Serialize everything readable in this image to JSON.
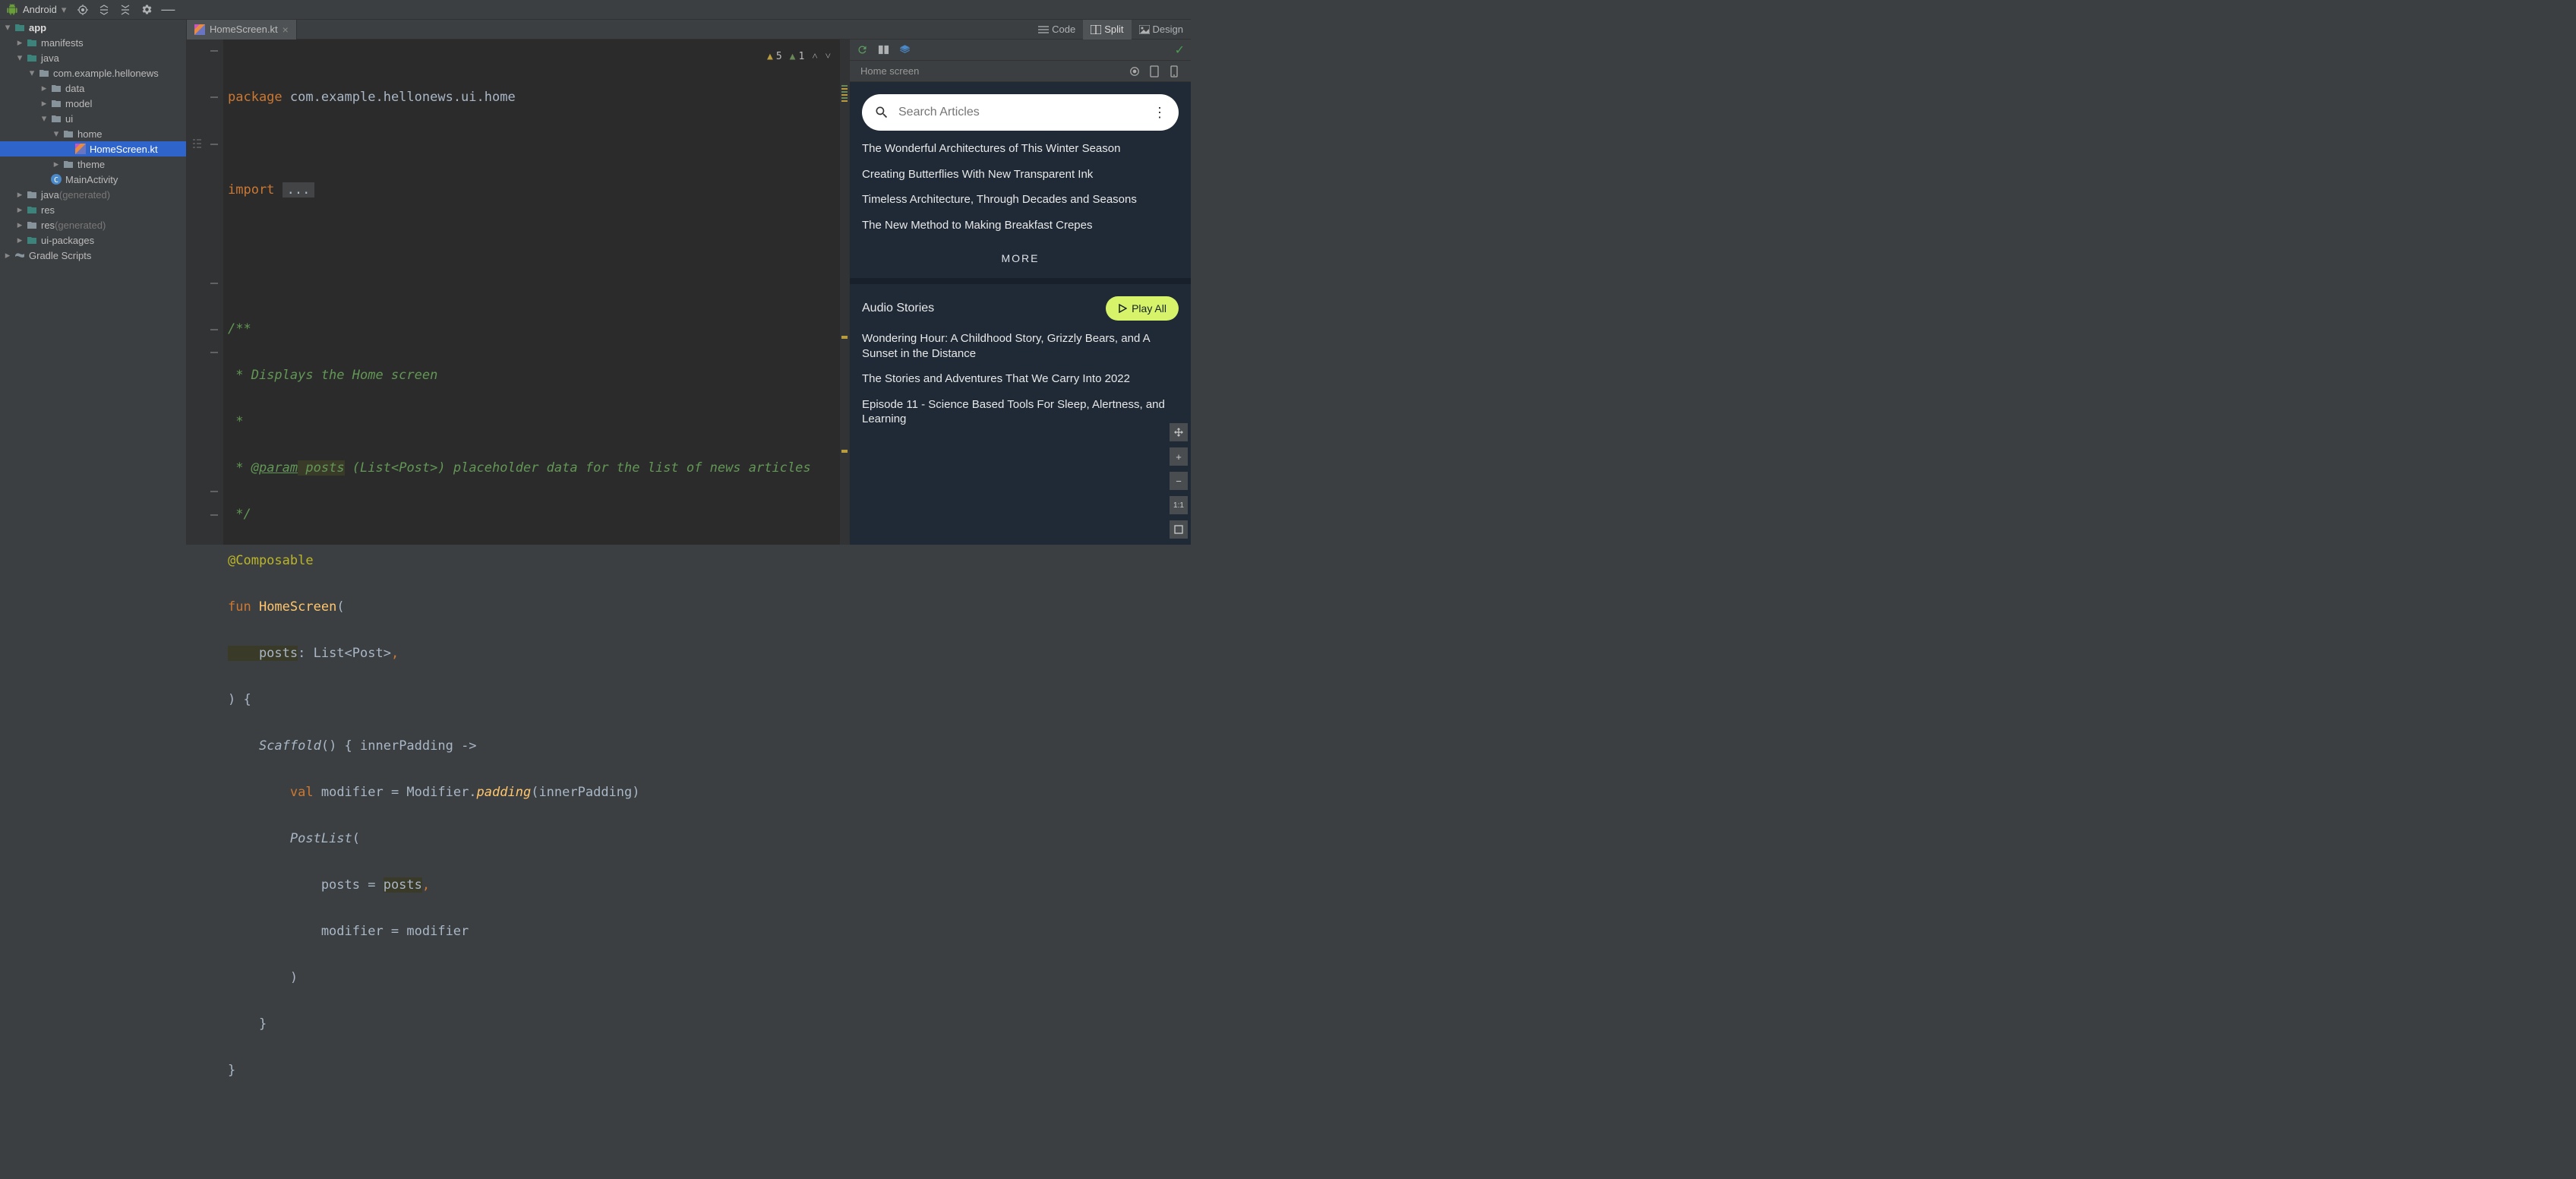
{
  "toolbar": {
    "project_type": "Android"
  },
  "tree": {
    "root": "app",
    "items": [
      {
        "label": "manifests",
        "depth": 1,
        "type": "folder-teal",
        "expand": "closed"
      },
      {
        "label": "java",
        "depth": 1,
        "type": "folder-teal",
        "expand": "open"
      },
      {
        "label": "com.example.hellonews",
        "depth": 2,
        "type": "folder-gray",
        "expand": "open"
      },
      {
        "label": "data",
        "depth": 3,
        "type": "folder-gray",
        "expand": "closed"
      },
      {
        "label": "model",
        "depth": 3,
        "type": "folder-gray",
        "expand": "closed"
      },
      {
        "label": "ui",
        "depth": 3,
        "type": "folder-gray",
        "expand": "open"
      },
      {
        "label": "home",
        "depth": 4,
        "type": "folder-gray",
        "expand": "open"
      },
      {
        "label": "HomeScreen.kt",
        "depth": 5,
        "type": "kt",
        "selected": true
      },
      {
        "label": "theme",
        "depth": 4,
        "type": "folder-gray",
        "expand": "closed"
      },
      {
        "label": "MainActivity",
        "depth": 3,
        "type": "class"
      },
      {
        "label": "java",
        "suffix": "(generated)",
        "depth": 1,
        "type": "gen",
        "expand": "closed"
      },
      {
        "label": "res",
        "depth": 1,
        "type": "res",
        "expand": "closed"
      },
      {
        "label": "res",
        "suffix": "(generated)",
        "depth": 1,
        "type": "gen",
        "expand": "closed"
      },
      {
        "label": "ui-packages",
        "depth": 1,
        "type": "folder-teal",
        "expand": "closed"
      }
    ],
    "gradle": "Gradle Scripts"
  },
  "tab": {
    "filename": "HomeScreen.kt"
  },
  "view_modes": {
    "code": "Code",
    "split": "Split",
    "design": "Design"
  },
  "warnings": {
    "yellow": "5",
    "green": "1"
  },
  "code": {
    "l1a": "package",
    "l1b": " com.example.hellonews.ui.home",
    "l3a": "import ",
    "l3b": "...",
    "l6": "/**",
    "l7": " * Displays the Home screen",
    "l8": " *",
    "l9a": " * ",
    "l9b": "@param",
    "l9c": " posts",
    "l9d": " (List<Post>) placeholder data for the list of news articles",
    "l10": " */",
    "l11": "@Composable",
    "l12a": "fun ",
    "l12b": "HomeScreen",
    "l12c": "(",
    "l13a": "    posts",
    "l13b": ": List<Post>",
    "l13c": ",",
    "l14": ") {",
    "l15a": "    ",
    "l15b": "Scaffold",
    "l15c": "() { innerPadding ->",
    "l16a": "        ",
    "l16b": "val",
    "l16c": " modifier = Modifier.",
    "l16d": "padding",
    "l16e": "(innerPadding)",
    "l17a": "        ",
    "l17b": "PostList",
    "l17c": "(",
    "l18a": "            posts = ",
    "l18b": "posts",
    "l18c": ",",
    "l19": "            modifier = modifier",
    "l20": "        )",
    "l21": "    }",
    "l22": "}"
  },
  "preview": {
    "header": "Home screen",
    "search_placeholder": "Search Articles",
    "articles": [
      "The Wonderful Architectures of This Winter Season",
      "Creating Butterflies With New Transparent Ink",
      "Timeless Architecture, Through Decades and Seasons",
      "The New Method to Making Breakfast Crepes"
    ],
    "more": "MORE",
    "audio_header": "Audio Stories",
    "play_all": "Play All",
    "audio": [
      "Wondering Hour: A Childhood Story, Grizzly Bears, and A Sunset in the Distance",
      "The Stories and Adventures That We Carry Into 2022",
      "Episode 11 - Science Based Tools For Sleep, Alertness, and Learning"
    ]
  },
  "zoom": {
    "ratio": "1:1"
  }
}
